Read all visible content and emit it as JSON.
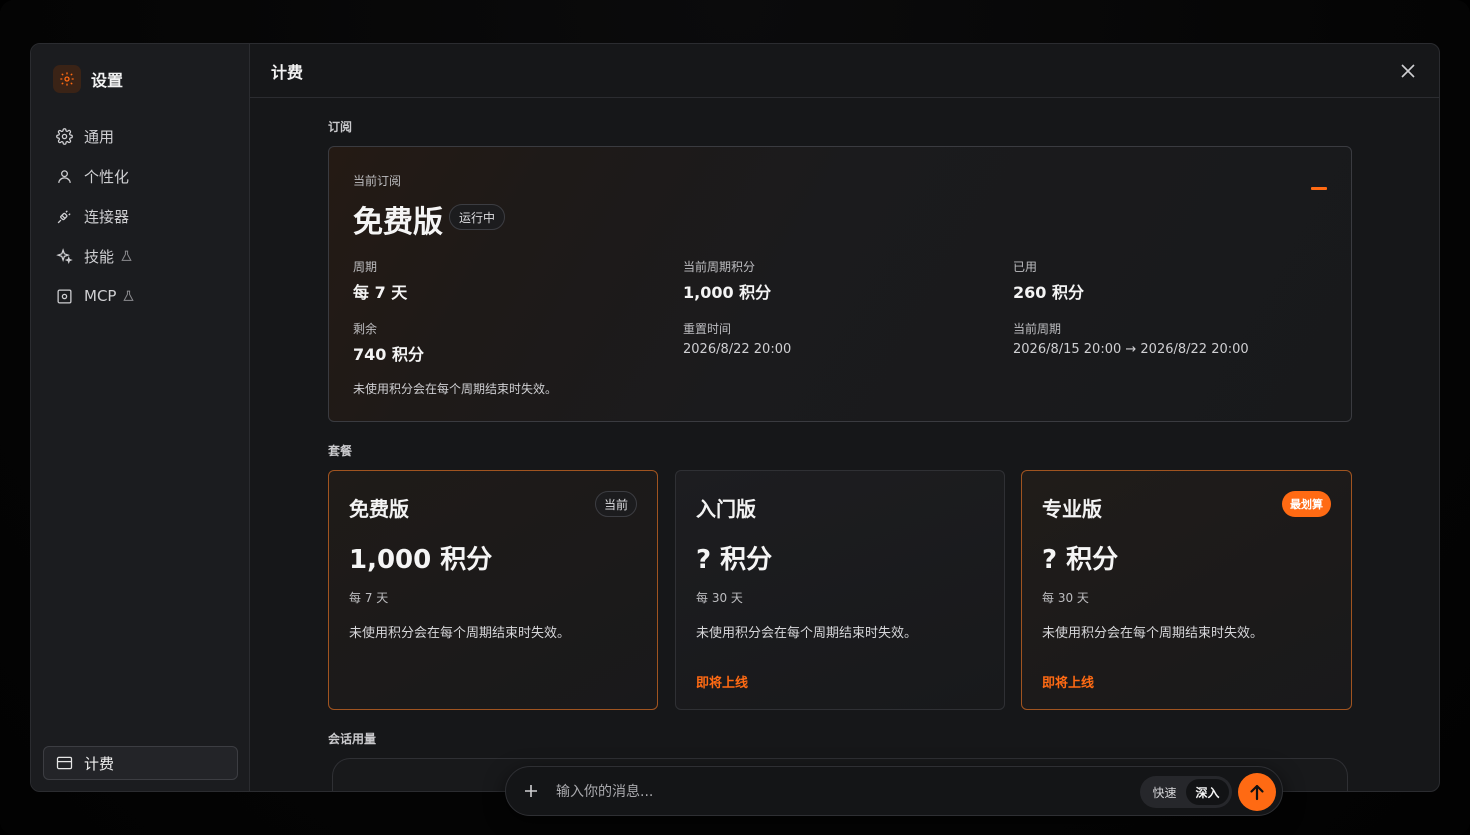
{
  "colors": {
    "accent": "#ff6a13",
    "panel": "#161719",
    "sidebar": "#1b1c1f"
  },
  "sidebar": {
    "title": "设置",
    "items": [
      {
        "label": "通用",
        "icon": "gear-icon",
        "beta": false
      },
      {
        "label": "个性化",
        "icon": "user-icon",
        "beta": false
      },
      {
        "label": "连接器",
        "icon": "plug-icon",
        "beta": false
      },
      {
        "label": "技能",
        "icon": "sparkle-icon",
        "beta": true
      },
      {
        "label": "MCP",
        "icon": "server-icon",
        "beta": true
      }
    ],
    "billing_label": "计费"
  },
  "header": {
    "title": "计费"
  },
  "subscription": {
    "section_label": "订阅",
    "current_label": "当前订阅",
    "plan_name": "免费版",
    "status": "运行中",
    "period_label": "周期",
    "period_value": "每 7 天",
    "credits_label": "当前周期积分",
    "credits_value": "1,000 积分",
    "used_label": "已用",
    "used_value": "260 积分",
    "remaining_label": "剩余",
    "remaining_value": "740 积分",
    "reset_label": "重置时间",
    "reset_value": "2026/8/22 20:00",
    "current_period_label": "当前周期",
    "current_period_value": "2026/8/15 20:00 → 2026/8/22 20:00",
    "note": "未使用积分会在每个周期结束时失效。"
  },
  "plans_section": {
    "label": "套餐",
    "plans": [
      {
        "name": "免费版",
        "credits": "1,000 积分",
        "period": "每 7 天",
        "note": "未使用积分会在每个周期结束时失效。",
        "badge": "当前",
        "action": ""
      },
      {
        "name": "入门版",
        "credits": "? 积分",
        "period": "每 30 天",
        "note": "未使用积分会在每个周期结束时失效。",
        "badge": "",
        "action": "即将上线"
      },
      {
        "name": "专业版",
        "credits": "? 积分",
        "period": "每 30 天",
        "note": "未使用积分会在每个周期结束时失效。",
        "badge": "最划算",
        "action": "即将上线"
      }
    ]
  },
  "usage_section": {
    "label": "会话用量"
  },
  "chat": {
    "placeholder": "输入你的消息...",
    "mode_fast": "快速",
    "mode_deep": "深入",
    "active_mode": "深入"
  }
}
